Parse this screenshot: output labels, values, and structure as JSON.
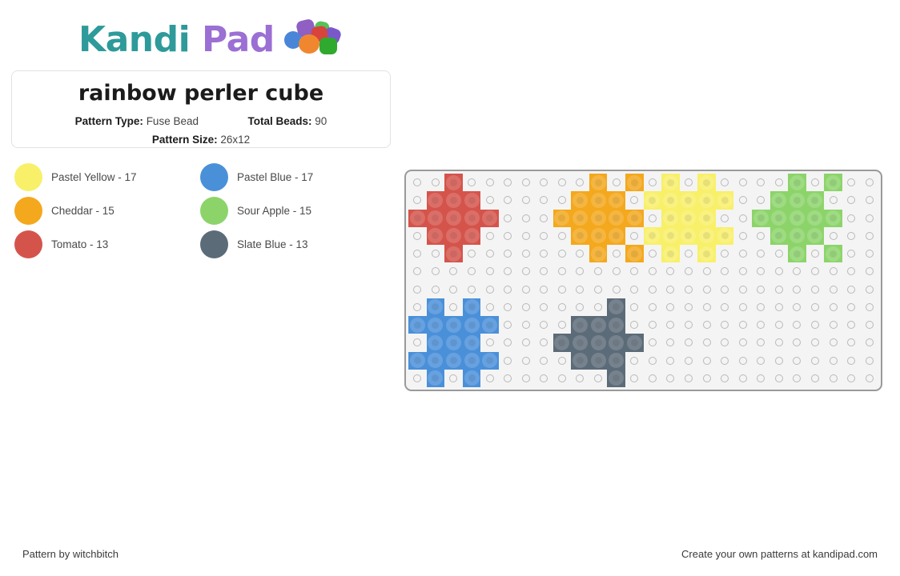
{
  "site": {
    "logo_text_primary": "Kandi",
    "logo_text_secondary": "Pad",
    "logo_primary_color": "#2e9a9a",
    "logo_secondary_color": "#9b6fd4"
  },
  "info": {
    "title": "rainbow perler cube",
    "pattern_type_label": "Pattern Type:",
    "pattern_type_value": "Fuse Bead",
    "total_beads_label": "Total Beads:",
    "total_beads_value": "90",
    "pattern_size_label": "Pattern Size:",
    "pattern_size_value": "26x12"
  },
  "legend": [
    {
      "name": "Pastel Yellow",
      "count": 17,
      "label": "Pastel Yellow - 17",
      "color": "#faf06a"
    },
    {
      "name": "Pastel Blue",
      "count": 17,
      "label": "Pastel Blue - 17",
      "color": "#4a90d9"
    },
    {
      "name": "Cheddar",
      "count": 15,
      "label": "Cheddar - 15",
      "color": "#f2a30c"
    },
    {
      "name": "Sour Apple",
      "count": 15,
      "label": "Sour Apple - 15",
      "color": "#8ed濃"
    },
    {
      "name": "Tomato",
      "count": 13,
      "label": "Tomato - 13",
      "color": "#d4453c"
    },
    {
      "name": "Slate Blue",
      "count": 13,
      "label": "Slate Blue - 13",
      "color": "#5c6b78"
    }
  ],
  "pegboard": {
    "columns": 26,
    "rows": 12,
    "peg_color": "#b9b9b9",
    "board_color": "#f4f4f4",
    "border_color": "#9a9a9a",
    "palette": {
      "T": "#d4544c",
      "C": "#f4a81d",
      "Y": "#f8f069",
      "G": "#8cd46a",
      "B": "#4a90d9",
      "S": "#5c6b78"
    },
    "color_names": {
      "T": "Tomato",
      "C": "Cheddar",
      "Y": "Pastel Yellow",
      "G": "Sour Apple",
      "B": "Pastel Blue",
      "S": "Slate Blue"
    },
    "grid": [
      "..T.......C.C.Y.Y....G.G..",
      ".TTT.....CCC.YYYYY..GGG...",
      "TTTTT...CCCCC.YYY..GGGGG..",
      ".TTT.....CCC.YYYYY..GGG...",
      "..T.......C.C.Y.Y....G.G..",
      "..........................",
      "..........................",
      ".B.B.......S..............",
      "BBBBB....SSS..............",
      ".BBB....SSSSS.............",
      "BBBBB....SSS..............",
      ".B.B.......S.............."
    ]
  },
  "footer": {
    "left_text": "Pattern by witchbitch",
    "right_text": "Create your own patterns at kandipad.com"
  }
}
